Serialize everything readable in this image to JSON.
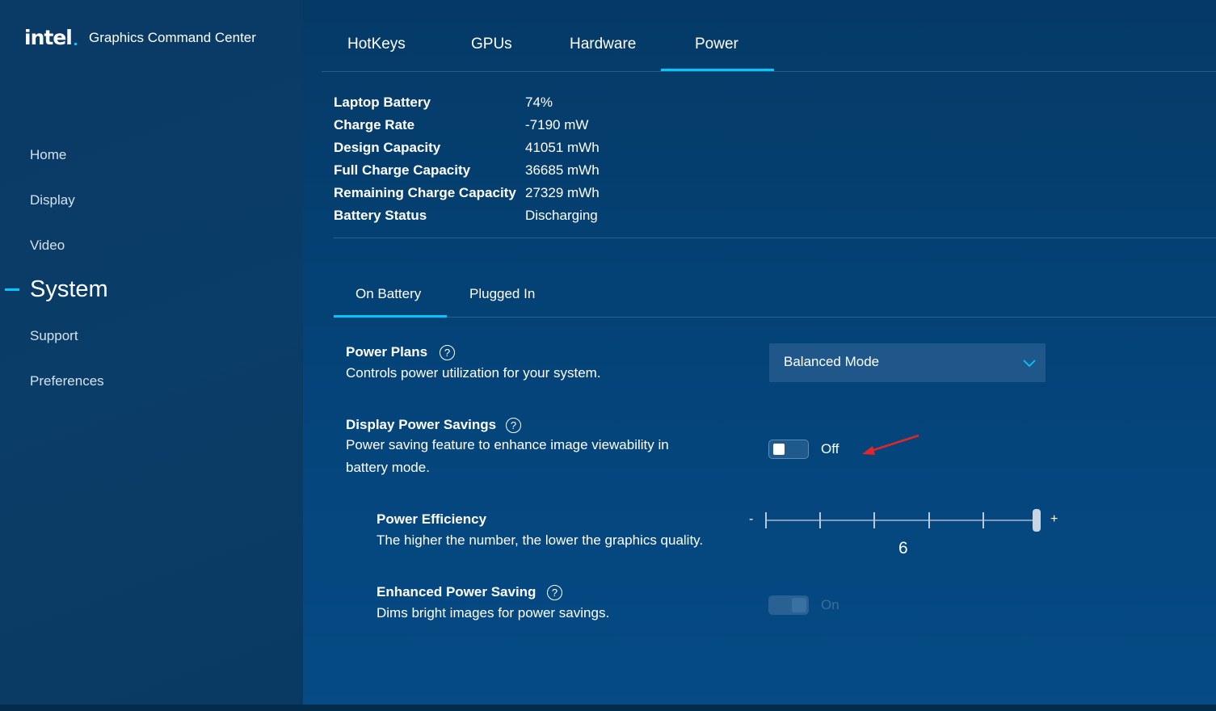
{
  "app": {
    "logo_text": "intel",
    "title": "Graphics Command Center"
  },
  "sidebar": {
    "items": [
      {
        "label": "Home"
      },
      {
        "label": "Display"
      },
      {
        "label": "Video"
      },
      {
        "label": "System",
        "active": true
      },
      {
        "label": "Support"
      },
      {
        "label": "Preferences"
      }
    ]
  },
  "tabs": [
    {
      "label": "HotKeys"
    },
    {
      "label": "GPUs"
    },
    {
      "label": "Hardware"
    },
    {
      "label": "Power",
      "active": true
    }
  ],
  "battery_info": [
    {
      "label": "Laptop Battery",
      "value": "74%"
    },
    {
      "label": "Charge Rate",
      "value": "-7190 mW"
    },
    {
      "label": "Design Capacity",
      "value": "41051 mWh"
    },
    {
      "label": "Full Charge Capacity",
      "value": "36685 mWh"
    },
    {
      "label": "Remaining Charge Capacity",
      "value": "27329 mWh"
    },
    {
      "label": "Battery Status",
      "value": "Discharging"
    }
  ],
  "subtabs": [
    {
      "label": "On Battery",
      "active": true
    },
    {
      "label": "Plugged In"
    }
  ],
  "settings": {
    "power_plans": {
      "title": "Power Plans",
      "description": "Controls power utilization for your system.",
      "selected": "Balanced Mode"
    },
    "display_power_savings": {
      "title": "Display Power Savings",
      "description_line1": "Power saving feature to enhance image viewability in",
      "description_line2": "battery mode.",
      "state_label": "Off",
      "enabled": false
    },
    "power_efficiency": {
      "title": "Power Efficiency",
      "description": "The higher the number, the lower the graphics quality.",
      "min_label": "-",
      "max_label": "+",
      "value": 6,
      "value_text": "6",
      "min": 1,
      "max": 6
    },
    "enhanced_power_saving": {
      "title": "Enhanced Power Saving",
      "description": "Dims bright images for power savings.",
      "state_label": "On",
      "enabled": true,
      "disabled": true
    }
  },
  "colors": {
    "accent": "#00c7fd",
    "annotation_arrow": "#e0262b"
  }
}
